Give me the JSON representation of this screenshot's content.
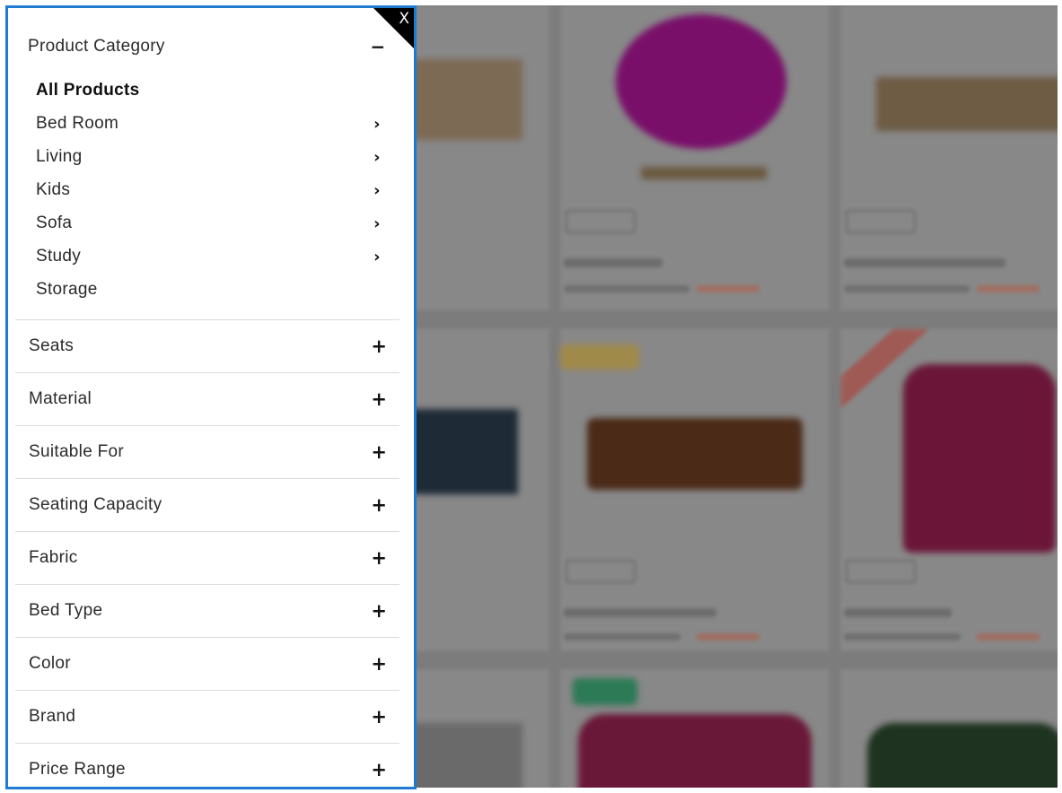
{
  "drawer": {
    "close_label": "X",
    "product_category": {
      "title": "Product Category",
      "toggle": "−",
      "items": [
        {
          "label": "All Products",
          "chevron": ""
        },
        {
          "label": "Bed Room",
          "chevron": "›"
        },
        {
          "label": "Living",
          "chevron": "›"
        },
        {
          "label": "Kids",
          "chevron": "›"
        },
        {
          "label": "Sofa",
          "chevron": "›"
        },
        {
          "label": "Study",
          "chevron": "›"
        },
        {
          "label": "Storage",
          "chevron": ""
        }
      ]
    },
    "filters": [
      {
        "label": "Seats",
        "toggle": "+"
      },
      {
        "label": "Material",
        "toggle": "+"
      },
      {
        "label": "Suitable For",
        "toggle": "+"
      },
      {
        "label": "Seating Capacity",
        "toggle": "+"
      },
      {
        "label": "Fabric",
        "toggle": "+"
      },
      {
        "label": "Bed Type",
        "toggle": "+"
      },
      {
        "label": "Color",
        "toggle": "+"
      },
      {
        "label": "Brand",
        "toggle": "+"
      },
      {
        "label": "Price Range",
        "toggle": "+"
      }
    ]
  },
  "colors": {
    "drawer_border": "#1f7bd2",
    "overlay": "#7c7c7c"
  }
}
